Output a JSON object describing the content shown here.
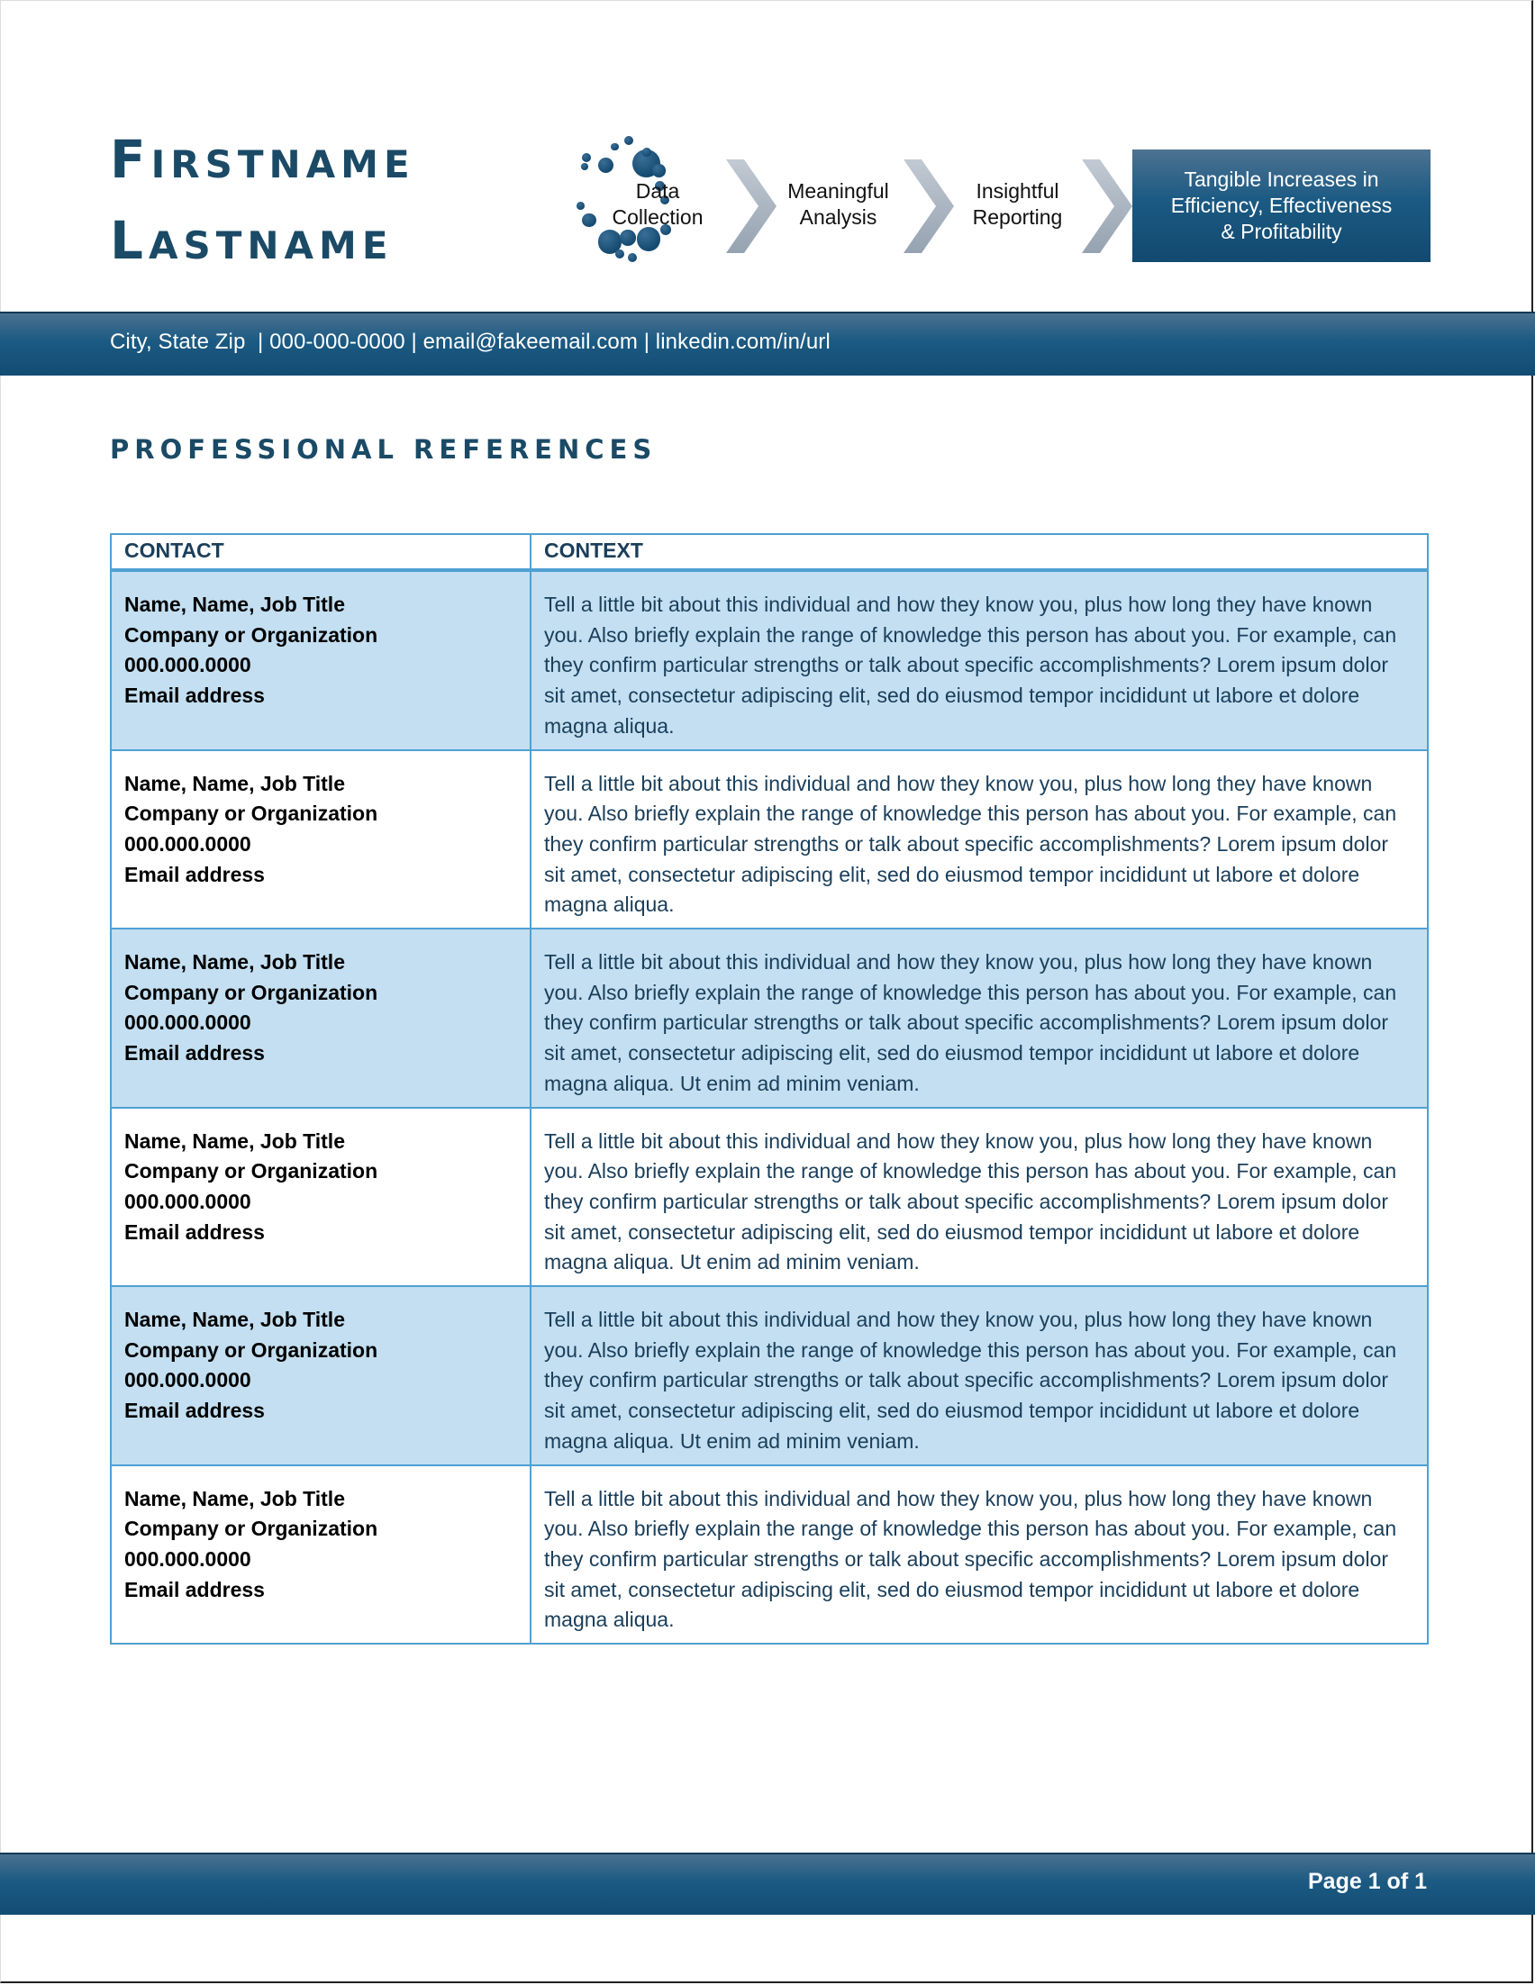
{
  "header": {
    "first_name": {
      "initial": "F",
      "rest": "irstname"
    },
    "last_name": {
      "initial": "L",
      "rest": "astname"
    },
    "process": {
      "steps": [
        {
          "line1": "Data",
          "line2": "Collection"
        },
        {
          "line1": "Meaningful",
          "line2": "Analysis"
        },
        {
          "line1": "Insightful",
          "line2": "Reporting"
        }
      ],
      "goal": {
        "line1": "Tangible Increases in",
        "line2": "Efficiency, Effectiveness",
        "line3": "& Profitability"
      },
      "icons": [
        "dots-cluster-icon",
        "chevron-right-icon"
      ]
    }
  },
  "contact_bar": {
    "location": "City, State Zip",
    "phone": "000-000-0000",
    "email": "email@fakeemail.com",
    "linkedin": "linkedin.com/in/url",
    "full_text": "City, State Zip  | 000-000-0000 | email@fakeemail.com | linkedin.com/in/url"
  },
  "section": {
    "title": "PROFESSIONAL REFERENCES"
  },
  "table": {
    "headers": [
      "CONTACT",
      "CONTEXT"
    ],
    "rows": [
      {
        "name": "Name, Name, Job Title",
        "company": "Company or Organization",
        "phone": "000.000.0000",
        "email": "Email address",
        "context": "Tell a little bit about this individual and how they know you, plus how long they have known you. Also briefly explain the range of knowledge this person has about you. For example, can they confirm particular strengths or talk about specific accomplishments? Lorem ipsum dolor sit amet, consectetur adipiscing elit, sed do eiusmod tempor incididunt ut labore et dolore magna aliqua."
      },
      {
        "name": "Name, Name, Job Title",
        "company": "Company or Organization",
        "phone": "000.000.0000",
        "email": "Email address",
        "context": "Tell a little bit about this individual and how they know you, plus how long they have known you. Also briefly explain the range of knowledge this person has about you. For example, can they confirm particular strengths or talk about specific accomplishments? Lorem ipsum dolor sit amet, consectetur adipiscing elit, sed do eiusmod tempor incididunt ut labore et dolore magna aliqua."
      },
      {
        "name": "Name, Name, Job Title",
        "company": "Company or Organization",
        "phone": "000.000.0000",
        "email": "Email address",
        "context": "Tell a little bit about this individual and how they know you, plus how long they have known you. Also briefly explain the range of knowledge this person has about you. For example, can they confirm particular strengths or talk about specific accomplishments? Lorem ipsum dolor sit amet, consectetur adipiscing elit, sed do eiusmod tempor incididunt ut labore et dolore magna aliqua. Ut enim ad minim veniam."
      },
      {
        "name": "Name, Name, Job Title",
        "company": "Company or Organization",
        "phone": "000.000.0000",
        "email": "Email address",
        "context": "Tell a little bit about this individual and how they know you, plus how long they have known you. Also briefly explain the range of knowledge this person has about you. For example, can they confirm particular strengths or talk about specific accomplishments? Lorem ipsum dolor sit amet, consectetur adipiscing elit, sed do eiusmod tempor incididunt ut labore et dolore magna aliqua. Ut enim ad minim veniam."
      },
      {
        "name": "Name, Name, Job Title",
        "company": "Company or Organization",
        "phone": "000.000.0000",
        "email": "Email address",
        "context": "Tell a little bit about this individual and how they know you, plus how long they have known you. Also briefly explain the range of knowledge this person has about you. For example, can they confirm particular strengths or talk about specific accomplishments? Lorem ipsum dolor sit amet, consectetur adipiscing elit, sed do eiusmod tempor incididunt ut labore et dolore magna aliqua. Ut enim ad minim veniam."
      },
      {
        "name": "Name, Name, Job Title",
        "company": "Company or Organization",
        "phone": "000.000.0000",
        "email": "Email address",
        "context": "Tell a little bit about this individual and how they know you, plus how long they have known you. Also briefly explain the range of knowledge this person has about you. For example, can they confirm particular strengths or talk about specific accomplishments? Lorem ipsum dolor sit amet, consectetur adipiscing elit, sed do eiusmod tempor incididunt ut labore et dolore magna aliqua."
      }
    ]
  },
  "footer": {
    "page_label": "Page 1 of 1"
  },
  "colors": {
    "brand_dark": "#1a4a66",
    "bar_blue": "#1b5a83",
    "table_border": "#4fa0d4",
    "row_shade": "#c3dff1",
    "chevron_gray": "#a9b4c0"
  }
}
